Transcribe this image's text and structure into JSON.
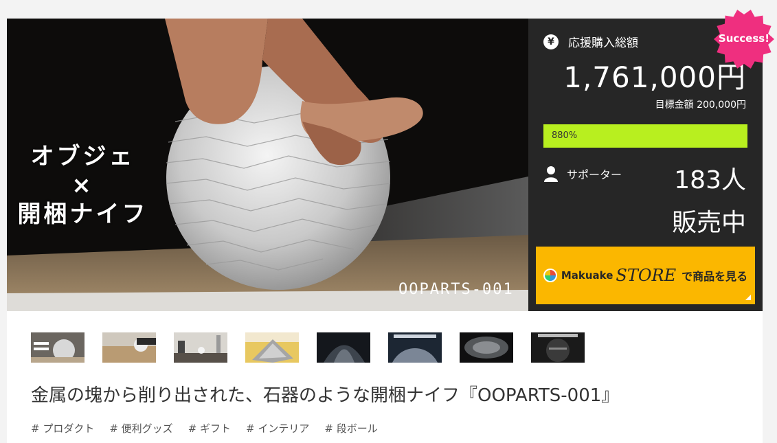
{
  "hero": {
    "title_line1": "オブジェ",
    "title_line2": "×",
    "title_line3": "開梱ナイフ",
    "code": "OOPARTS-001"
  },
  "badge": {
    "label": "Success!",
    "color": "#ef2f7f"
  },
  "funding": {
    "total_label": "応援購入総額",
    "total_icon": "yen-icon",
    "total_amount": "1,761,000円",
    "goal_text": "目標金額 200,000円",
    "progress_label": "880%",
    "progress_fraction": 1.0,
    "progress_color": "#b8ef1f",
    "supporters_label": "サポーター",
    "supporters_icon": "person-icon",
    "supporters_count": "183人",
    "status": "販売中"
  },
  "store_button": {
    "brand": "Makuake",
    "store": "STORE",
    "cta": "で商品を見る",
    "color": "#fbb700"
  },
  "thumbnails": [
    {
      "label": "thumbnail-1"
    },
    {
      "label": "thumbnail-2"
    },
    {
      "label": "thumbnail-3"
    },
    {
      "label": "thumbnail-4"
    },
    {
      "label": "thumbnail-5"
    },
    {
      "label": "thumbnail-6"
    },
    {
      "label": "thumbnail-7"
    },
    {
      "label": "thumbnail-8"
    }
  ],
  "product_title": "金属の塊から削り出された、石器のような開梱ナイフ『OOPARTS-001』",
  "tags": [
    "# プロダクト",
    "# 便利グッズ",
    "# ギフト",
    "# インテリア",
    "# 段ボール"
  ]
}
